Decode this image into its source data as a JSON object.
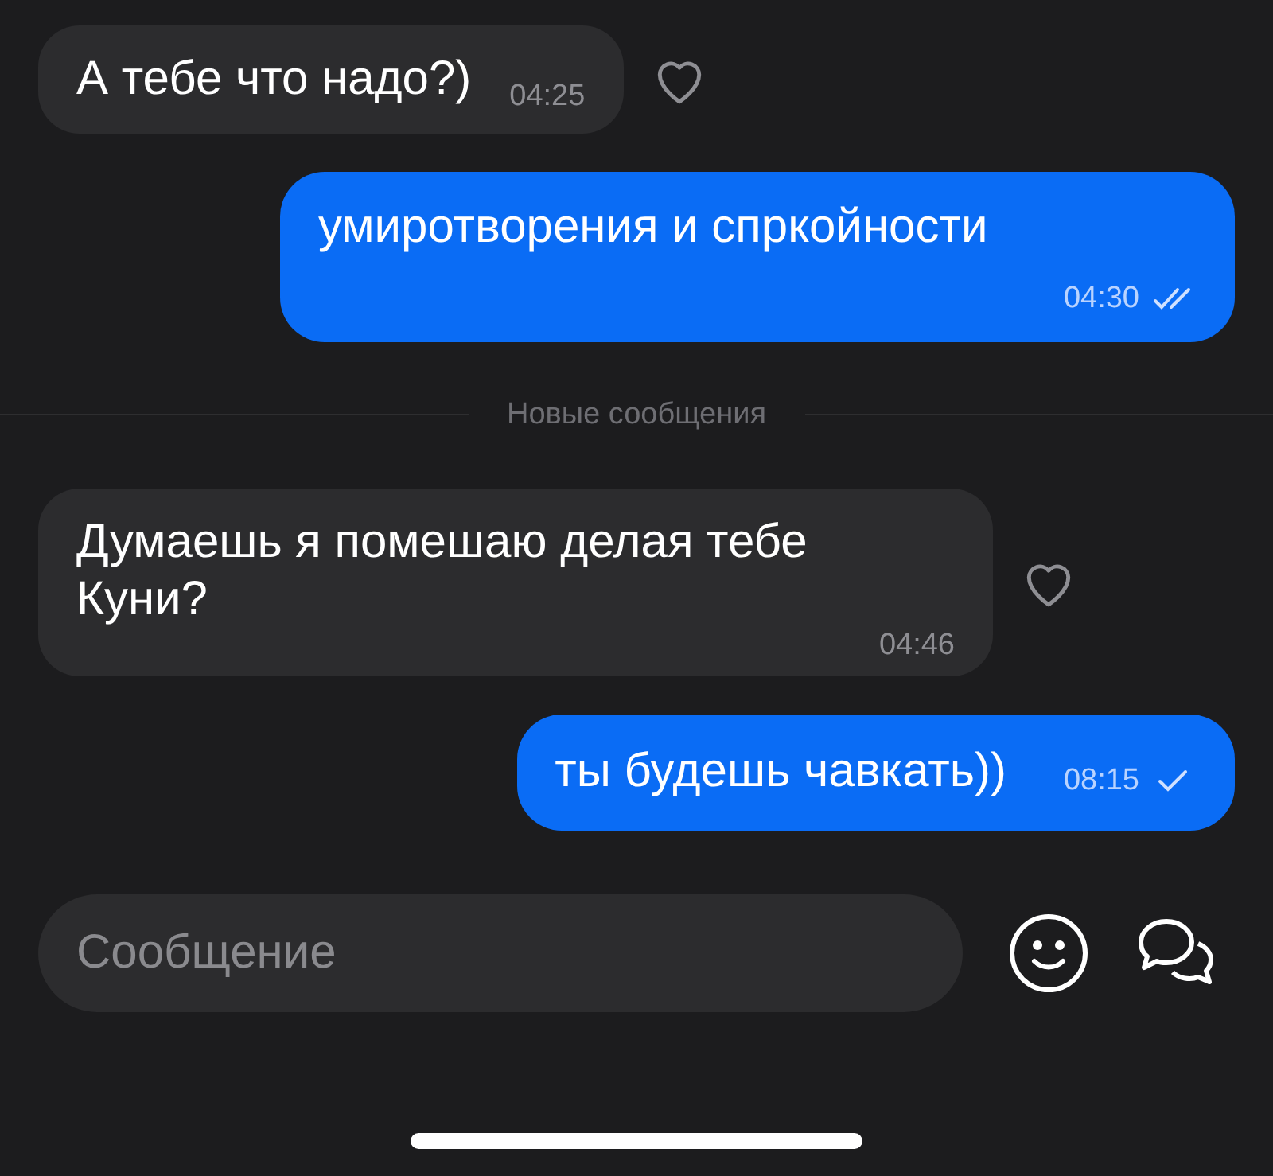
{
  "messages": [
    {
      "kind": "incoming",
      "text": "А тебе что надо?)",
      "time": "04:25",
      "liked": false
    },
    {
      "kind": "outgoing",
      "text": "умиротворения и спркойности",
      "time": "04:30",
      "read": true
    },
    {
      "kind": "divider",
      "text": "Новые сообщения"
    },
    {
      "kind": "incoming",
      "text": "Думаешь я помешаю делая тебе Куни?",
      "time": "04:46",
      "liked": false
    },
    {
      "kind": "outgoing",
      "text": "ты будешь чавкать))",
      "time": "08:15",
      "read": false
    }
  ],
  "composer": {
    "placeholder": "Сообщение"
  }
}
